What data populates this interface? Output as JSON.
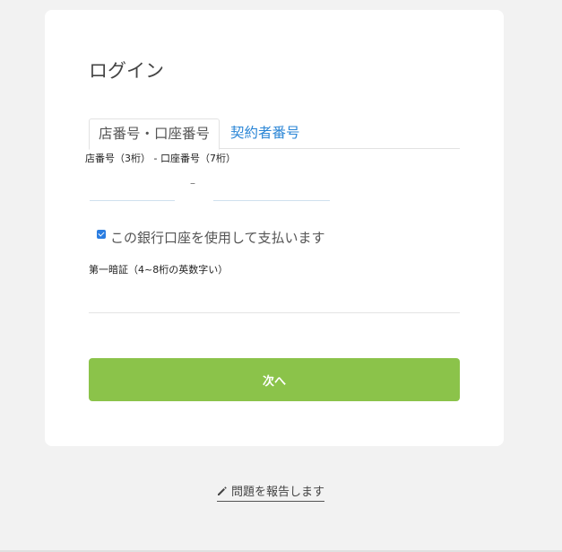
{
  "login": {
    "title": "ログイン",
    "tabs": [
      {
        "label": "店番号・口座番号",
        "active": true
      },
      {
        "label": "契約者番号",
        "active": false
      }
    ],
    "account_field_label": "店番号（3桁） - 口座番号（7桁）",
    "branch_value": "",
    "account_value": "",
    "separator": "–",
    "use_account_checked": true,
    "use_account_label": "この銀行口座を使用して支払います",
    "pin_label": "第一暗証（4~8桁の英数字い）",
    "pin_value": "",
    "next_label": "次へ"
  },
  "footer": {
    "report_icon": "pencil-icon",
    "report_label": "問題を報告します"
  },
  "colors": {
    "accent_green": "#8bc34a",
    "link_blue": "#2b86d6",
    "checkbox_blue": "#2a7de1",
    "page_bg": "#f2f2f2"
  }
}
